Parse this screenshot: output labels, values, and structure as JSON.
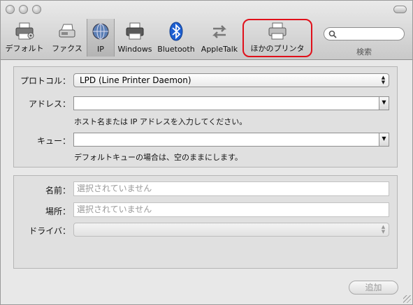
{
  "toolbar": {
    "items": [
      {
        "label": "デフォルト",
        "icon": "default-printer-icon"
      },
      {
        "label": "ファクス",
        "icon": "fax-icon"
      },
      {
        "label": "IP",
        "icon": "ip-globe-icon"
      },
      {
        "label": "Windows",
        "icon": "windows-printer-icon"
      },
      {
        "label": "Bluetooth",
        "icon": "bluetooth-icon"
      },
      {
        "label": "AppleTalk",
        "icon": "appletalk-icon"
      },
      {
        "label": "ほかのプリンタ",
        "icon": "other-printer-icon"
      }
    ],
    "selected": "IP",
    "search_label": "検索",
    "search_placeholder": ""
  },
  "protocol": {
    "label": "プロトコル：",
    "value": "LPD (Line Printer Daemon)"
  },
  "address": {
    "label": "アドレス：",
    "value": "",
    "hint": "ホスト名または IP アドレスを入力してください。"
  },
  "queue": {
    "label": "キュー：",
    "value": "",
    "hint": "デフォルトキューの場合は、空のままにします。"
  },
  "info": {
    "name_label": "名前：",
    "name_value": "選択されていません",
    "location_label": "場所：",
    "location_value": "選択されていません",
    "driver_label": "ドライバ：",
    "driver_value": ""
  },
  "add_button": "追加",
  "colors": {
    "highlight": "#e0101a",
    "bluetooth": "#1d5fd1"
  }
}
